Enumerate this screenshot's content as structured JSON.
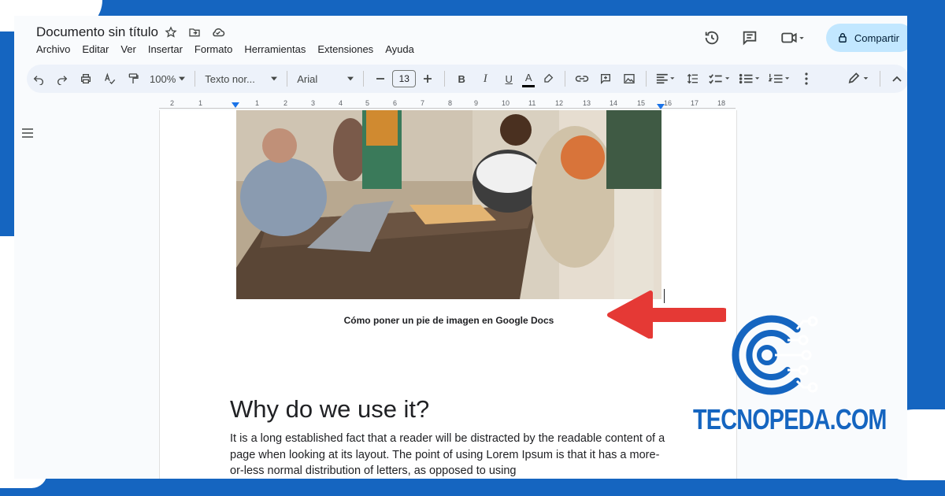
{
  "doc": {
    "title": "Documento sin título"
  },
  "menu": [
    "Archivo",
    "Editar",
    "Ver",
    "Insertar",
    "Formato",
    "Herramientas",
    "Extensiones",
    "Ayuda"
  ],
  "share": {
    "label": "Compartir"
  },
  "toolbar": {
    "zoom": "100%",
    "style": "Texto nor...",
    "font": "Arial",
    "font_size": "13",
    "bold": "B",
    "italic": "I",
    "underline": "U",
    "text_color": "A"
  },
  "ruler": {
    "numbers": [
      "2",
      "1",
      "1",
      "2",
      "3",
      "4",
      "5",
      "6",
      "7",
      "8",
      "9",
      "10",
      "11",
      "12",
      "13",
      "14",
      "15",
      "16",
      "17",
      "18"
    ]
  },
  "content": {
    "caption": "Cómo poner un pie de imagen en Google Docs",
    "heading": "Why do we use it?",
    "paragraph": "It is a long established fact that a reader will be distracted by the readable content of a page when looking at its layout. The point of using Lorem Ipsum is that it has a more-or-less normal distribution of letters, as opposed to using"
  },
  "brand": {
    "text": "TECNOPEDA.COM",
    "color": "#1565c0"
  },
  "colors": {
    "frame": "#1565c0",
    "share_bg": "#c2e7ff",
    "toolbar_bg": "#edf2fa",
    "arrow": "#e53935"
  }
}
